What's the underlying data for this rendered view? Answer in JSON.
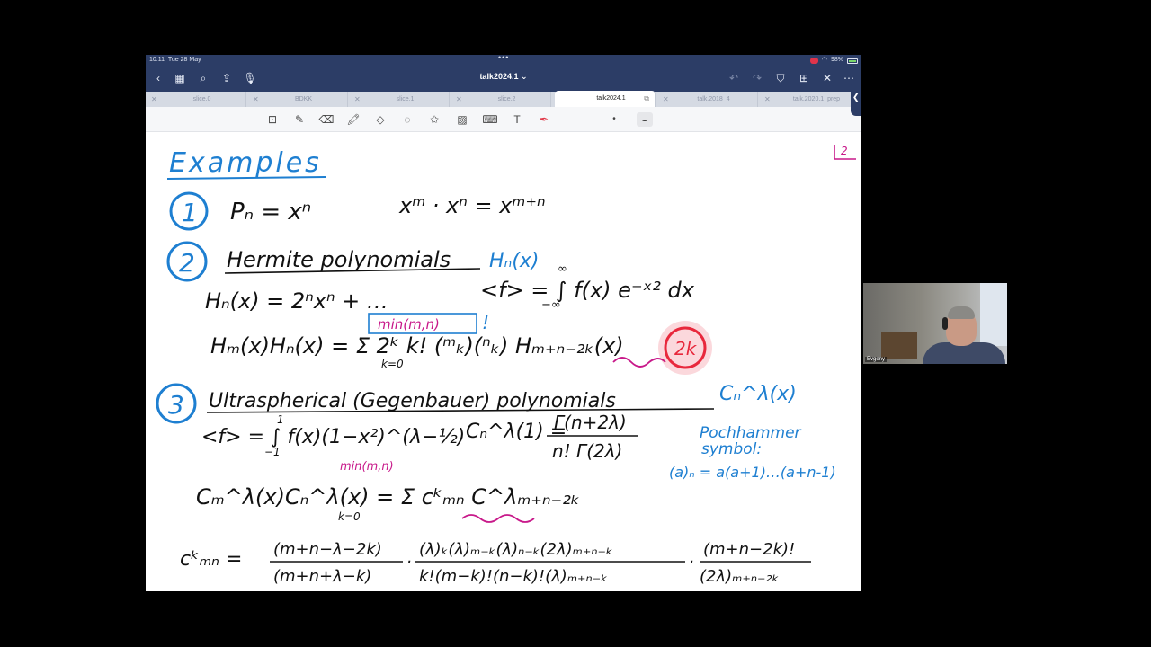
{
  "status_bar": {
    "time": "10:11",
    "date": "Tue 28 May",
    "dots": "•••",
    "battery": "98%"
  },
  "navbar": {
    "title": "talk2024.1",
    "chevron": "⌄"
  },
  "tabs": [
    {
      "label": "slice.0"
    },
    {
      "label": "BDKK"
    },
    {
      "label": "slice.1"
    },
    {
      "label": "slice.2"
    },
    {
      "label": "talk2024.1"
    },
    {
      "label": "talk.2018_4"
    },
    {
      "label": "talk.2020.1_prep"
    }
  ],
  "page": {
    "number": "2",
    "heading": "Examples",
    "items": [
      "1",
      "2",
      "3"
    ],
    "notes": {
      "hermite_title": "Hermite polynomials",
      "hermite_symbol": "Hₙ(x)",
      "ultra_title": "Ultraspherical (Gegenbauer) polynomials",
      "ultra_symbol": "Cₙ^λ(x)",
      "min_mn": "min(m,n)",
      "pochhammer_1": "Pochhammer",
      "pochhammer_2": "symbol:",
      "pochhammer_def": "(a)ₙ = a(a+1)…(a+n-1)",
      "circled": "2k"
    }
  },
  "video": {
    "participant": "Evgeny"
  },
  "colors": {
    "chrome": "#2c3d66",
    "ink_black": "#111111",
    "ink_blue": "#1e7fd1",
    "ink_magenta": "#c8198a",
    "laser_red": "#e8283c"
  }
}
